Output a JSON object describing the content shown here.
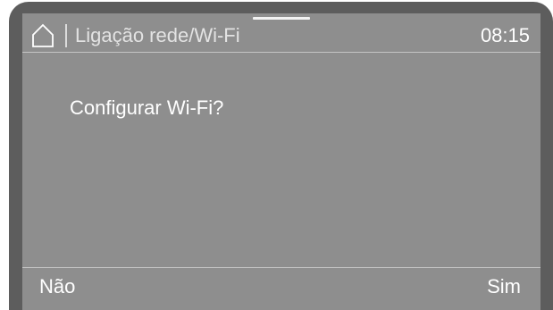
{
  "header": {
    "home_icon": "home-icon",
    "title": "Ligação rede/Wi-Fi",
    "time": "08:15"
  },
  "dialog": {
    "prompt": "Configurar Wi-Fi?"
  },
  "softkeys": {
    "left_label": "Não",
    "right_label": "Sim"
  },
  "colors": {
    "screen_background": "#8e8e8e",
    "bezel": "#5d5d5d",
    "text": "#ffffff"
  }
}
